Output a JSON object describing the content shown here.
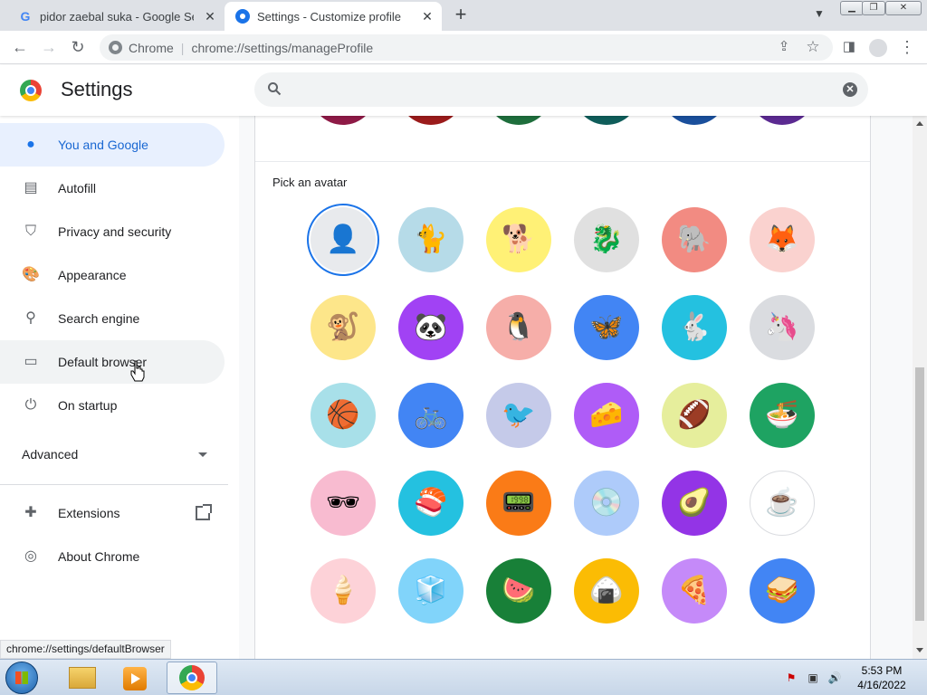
{
  "tabs": [
    {
      "title": "pidor zaebal suka - Google Search",
      "icon": "google-icon"
    },
    {
      "title": "Settings - Customize profile",
      "icon": "settings-gear-icon"
    }
  ],
  "new_tab_label": "+",
  "omnibox": {
    "site": "Chrome",
    "separator": "|",
    "url": "chrome://settings/manageProfile"
  },
  "header": {
    "title": "Settings",
    "search_value": ""
  },
  "sidebar": {
    "items": [
      {
        "label": "You and Google",
        "icon": "person-icon",
        "state": "active"
      },
      {
        "label": "Autofill",
        "icon": "clipboard-icon"
      },
      {
        "label": "Privacy and security",
        "icon": "shield-icon"
      },
      {
        "label": "Appearance",
        "icon": "palette-icon"
      },
      {
        "label": "Search engine",
        "icon": "search-icon"
      },
      {
        "label": "Default browser",
        "icon": "browser-window-icon",
        "state": "hover"
      },
      {
        "label": "On startup",
        "icon": "power-icon"
      }
    ],
    "advanced_label": "Advanced",
    "extensions_label": "Extensions",
    "about_label": "About Chrome"
  },
  "content": {
    "section_label": "Pick an avatar",
    "color_stubs": [
      "#8e1a46",
      "#9b1b1b",
      "#1e6e3c",
      "#0f5d5a",
      "#1a4f9c",
      "#5b2a91"
    ],
    "avatars": [
      {
        "name": "generic-person",
        "bg": "#e8eaed",
        "glyph": "👤",
        "selected": true
      },
      {
        "name": "origami-cat",
        "bg": "#b6dbe8",
        "glyph": "🐈"
      },
      {
        "name": "origami-corgi",
        "bg": "#fff176",
        "glyph": "🐕"
      },
      {
        "name": "origami-dragon",
        "bg": "#e0e0e0",
        "glyph": "🐉"
      },
      {
        "name": "origami-elephant",
        "bg": "#f28b82",
        "glyph": "🐘"
      },
      {
        "name": "origami-fox",
        "bg": "#fad2cf",
        "glyph": "🦊"
      },
      {
        "name": "origami-monkey",
        "bg": "#fde68a",
        "glyph": "🐒"
      },
      {
        "name": "origami-panda",
        "bg": "#a142f4",
        "glyph": "🐼"
      },
      {
        "name": "origami-penguin",
        "bg": "#f6aea9",
        "glyph": "🐧"
      },
      {
        "name": "origami-butterfly",
        "bg": "#4285f4",
        "glyph": "🦋"
      },
      {
        "name": "origami-rabbit",
        "bg": "#24c1e0",
        "glyph": "🐇"
      },
      {
        "name": "origami-unicorn",
        "bg": "#dadce0",
        "glyph": "🦄"
      },
      {
        "name": "basketball",
        "bg": "#a8e0e9",
        "glyph": "🏀"
      },
      {
        "name": "bike",
        "bg": "#4285f4",
        "glyph": "🚲"
      },
      {
        "name": "bird",
        "bg": "#c5cae9",
        "glyph": "🐦"
      },
      {
        "name": "cheese",
        "bg": "#af5cf7",
        "glyph": "🧀"
      },
      {
        "name": "football",
        "bg": "#e6ee9c",
        "glyph": "🏈"
      },
      {
        "name": "ramen",
        "bg": "#1ea362",
        "glyph": "🍜"
      },
      {
        "name": "sunglasses",
        "bg": "#f8bbd0",
        "glyph": "🕶"
      },
      {
        "name": "sushi",
        "bg": "#24c1e0",
        "glyph": "🍣"
      },
      {
        "name": "tamagotchi",
        "bg": "#fa7b17",
        "glyph": "📟"
      },
      {
        "name": "vinyl",
        "bg": "#aecbfa",
        "glyph": "💿"
      },
      {
        "name": "avocado",
        "bg": "#9334e6",
        "glyph": "🥑"
      },
      {
        "name": "cappuccino",
        "bg": "#ffffff",
        "glyph": "☕"
      },
      {
        "name": "ice-cream",
        "bg": "#fdd2d8",
        "glyph": "🍦"
      },
      {
        "name": "ice-water",
        "bg": "#81d4fa",
        "glyph": "🧊"
      },
      {
        "name": "watermelon",
        "bg": "#188038",
        "glyph": "🍉"
      },
      {
        "name": "onigiri",
        "bg": "#fbbc04",
        "glyph": "🍙"
      },
      {
        "name": "pizza",
        "bg": "#c58af9",
        "glyph": "🍕"
      },
      {
        "name": "sandwich",
        "bg": "#4285f4",
        "glyph": "🥪"
      }
    ]
  },
  "status_bar_text": "chrome://settings/defaultBrowser",
  "taskbar": {
    "time": "5:53 PM",
    "date": "4/16/2022"
  },
  "colors": {
    "accent": "#1a73e8",
    "active_bg": "#e8f0fe",
    "active_text": "#1967d2"
  }
}
